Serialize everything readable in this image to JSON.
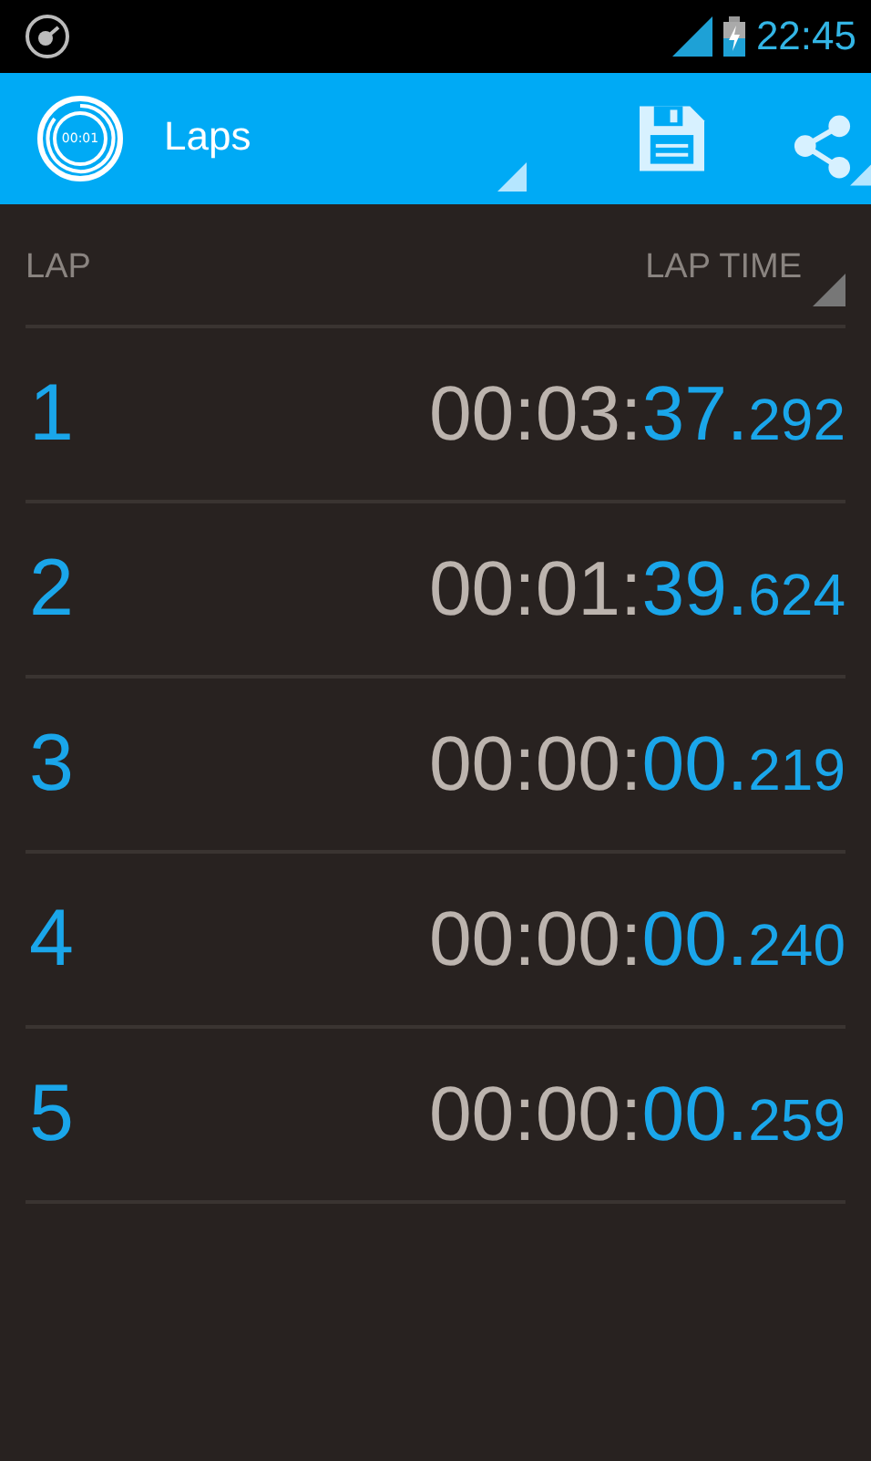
{
  "status_bar": {
    "time": "22:45"
  },
  "action_bar": {
    "logo_text": "00:01",
    "title": "Laps"
  },
  "table": {
    "columns": [
      "LAP",
      "LAP TIME"
    ],
    "rows": [
      {
        "lap": "1",
        "hms": "00:03:",
        "seconds": "37.",
        "millis": "292"
      },
      {
        "lap": "2",
        "hms": "00:01:",
        "seconds": "39.",
        "millis": "624"
      },
      {
        "lap": "3",
        "hms": "00:00:",
        "seconds": "00.",
        "millis": "219"
      },
      {
        "lap": "4",
        "hms": "00:00:",
        "seconds": "00.",
        "millis": "240"
      },
      {
        "lap": "5",
        "hms": "00:00:",
        "seconds": "00.",
        "millis": "259"
      }
    ]
  }
}
